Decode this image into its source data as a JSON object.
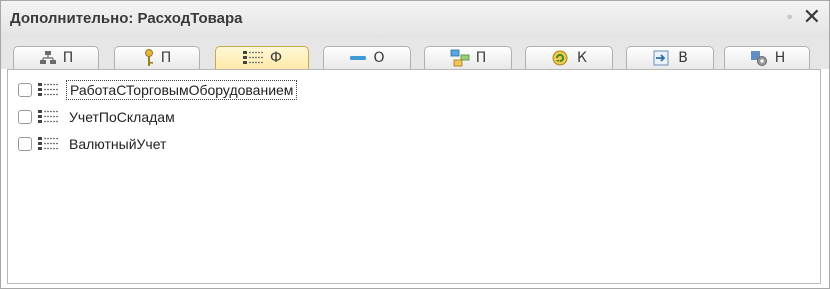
{
  "window": {
    "title": "Дополнительно: РасходТовара"
  },
  "tabs": [
    {
      "label": "П",
      "icon": "hierarchy-icon"
    },
    {
      "label": "П",
      "icon": "key-icon"
    },
    {
      "label": "Ф",
      "icon": "list-icon",
      "active": true
    },
    {
      "label": "О",
      "icon": "minus-bar-icon"
    },
    {
      "label": "П",
      "icon": "tree-grid-icon"
    },
    {
      "label": "К",
      "icon": "command-refresh-icon"
    },
    {
      "label": "В",
      "icon": "input-form-icon"
    },
    {
      "label": "Н",
      "icon": "settings-icon"
    }
  ],
  "options": [
    {
      "label": "РаботаСТорговымОборудованием",
      "checked": false,
      "focused": true
    },
    {
      "label": "УчетПоСкладам",
      "checked": false,
      "focused": false
    },
    {
      "label": "ВалютныйУчет",
      "checked": false,
      "focused": false
    }
  ],
  "colors": {
    "active_tab": "#ffe9a8",
    "border": "#b8b8b8"
  }
}
